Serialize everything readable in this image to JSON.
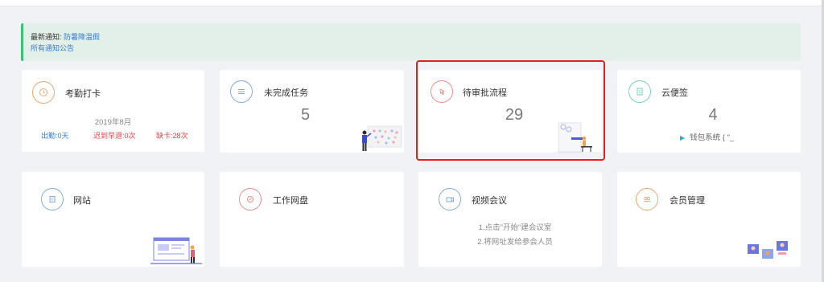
{
  "notice": {
    "label": "最新通知:",
    "latest": "防暑降温假",
    "all_link": "所有通知公告"
  },
  "cards": {
    "attendance": {
      "title": "考勤打卡",
      "month": "2019年8月",
      "present": "出勤:0天",
      "late": "迟到早退:0次",
      "missing": "缺卡:28次"
    },
    "tasks": {
      "title": "未完成任务",
      "count": "5"
    },
    "approvals": {
      "title": "待审批流程",
      "count": "29"
    },
    "notes": {
      "title": "云便签",
      "count": "4",
      "item": "钱包系统 { \"_"
    },
    "website": {
      "title": "网站"
    },
    "drive": {
      "title": "工作网盘"
    },
    "video": {
      "title": "视频会议",
      "step1": "1.点击\"开始\"建会议室",
      "step2": "2.将网址发给参会人员"
    },
    "members": {
      "title": "会员管理"
    }
  },
  "colors": {
    "accent_green": "#3cc27b",
    "link_blue": "#2f7fd8",
    "highlight_red": "#e02020"
  }
}
